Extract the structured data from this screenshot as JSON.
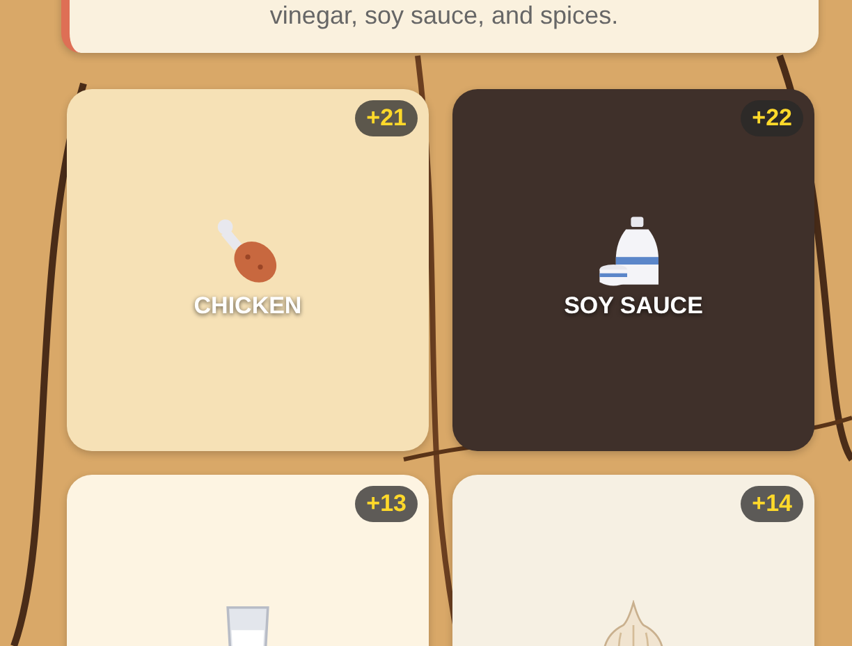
{
  "description": {
    "text": "vinegar, soy sauce, and spices."
  },
  "ingredients": [
    {
      "label": "CHICKEN",
      "points": "+21",
      "kind": "drumstick",
      "color": "#f6e1b6"
    },
    {
      "label": "SOY SAUCE",
      "points": "+22",
      "kind": "bottle",
      "color": "#3f302a"
    },
    {
      "points": "+13",
      "kind": "glass",
      "color": "#fdf4e2"
    },
    {
      "points": "+14",
      "kind": "garlic",
      "color": "#f6f0e3"
    }
  ]
}
